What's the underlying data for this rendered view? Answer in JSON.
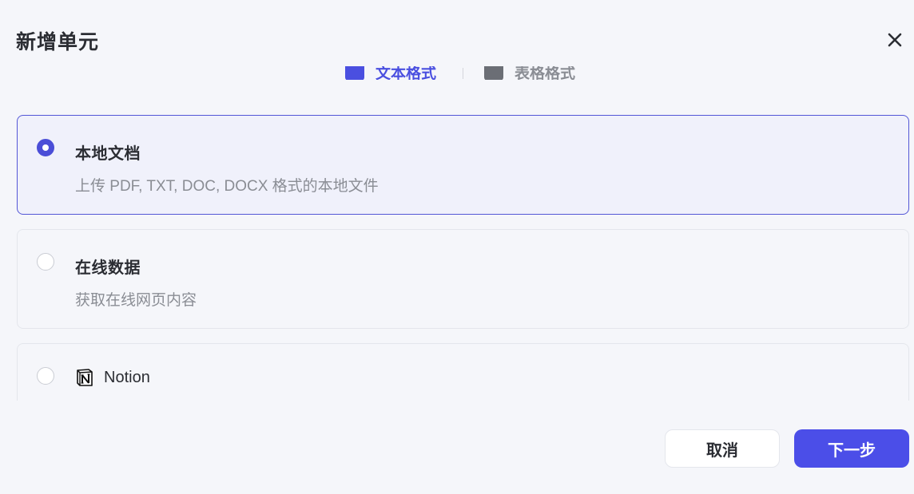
{
  "dialog": {
    "title": "新增单元",
    "close_icon": "close-icon"
  },
  "tabs": [
    {
      "label": "文本格式",
      "active": true,
      "icon": "text-format-icon"
    },
    {
      "label": "表格格式",
      "active": false,
      "icon": "table-format-icon"
    }
  ],
  "options": [
    {
      "title": "本地文档",
      "description": "上传 PDF, TXT, DOC, DOCX 格式的本地文件",
      "selected": true
    },
    {
      "title": "在线数据",
      "description": "获取在线网页内容",
      "selected": false
    },
    {
      "title": "Notion",
      "icon": "notion-icon",
      "selected": false
    }
  ],
  "footer": {
    "cancel_label": "取消",
    "next_label": "下一步"
  },
  "colors": {
    "accent": "#4b4ee8",
    "selected_border": "#5356d6",
    "background": "#f5f6fa"
  }
}
